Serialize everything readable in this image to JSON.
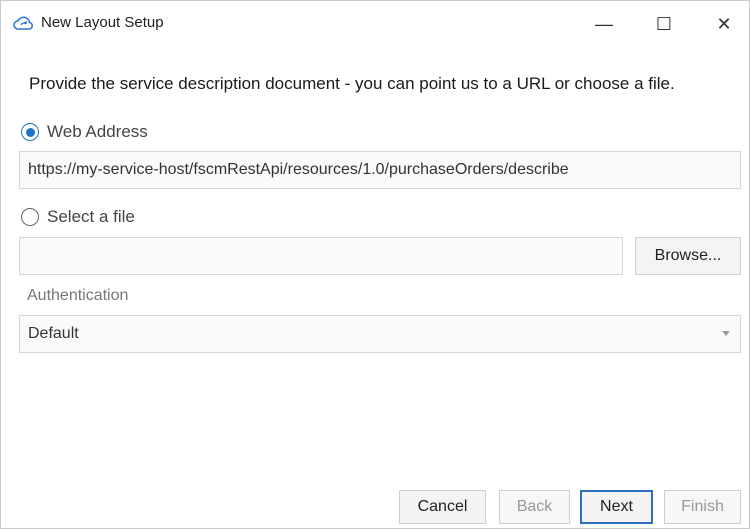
{
  "window": {
    "title": "New Layout Setup",
    "controls": {
      "minimize": "—",
      "maximize": "☐",
      "close": "✕"
    }
  },
  "instruction": "Provide the service description document - you can point us to a URL or choose a file.",
  "source": {
    "web_address_label": "Web Address",
    "web_address_selected": true,
    "url_value": "https://my-service-host/fscmRestApi/resources/1.0/purchaseOrders/describe",
    "file_label": "Select a file",
    "file_selected": false,
    "file_value": "",
    "browse_label": "Browse..."
  },
  "authentication": {
    "label": "Authentication",
    "selected": "Default"
  },
  "footer": {
    "cancel": "Cancel",
    "back": "Back",
    "next": "Next",
    "finish": "Finish"
  },
  "colors": {
    "accent": "#1a73c8",
    "default_button_border": "#2c6fc0"
  },
  "icons": {
    "app": "cloud-sync-icon",
    "dropdown": "caret-down-icon"
  }
}
